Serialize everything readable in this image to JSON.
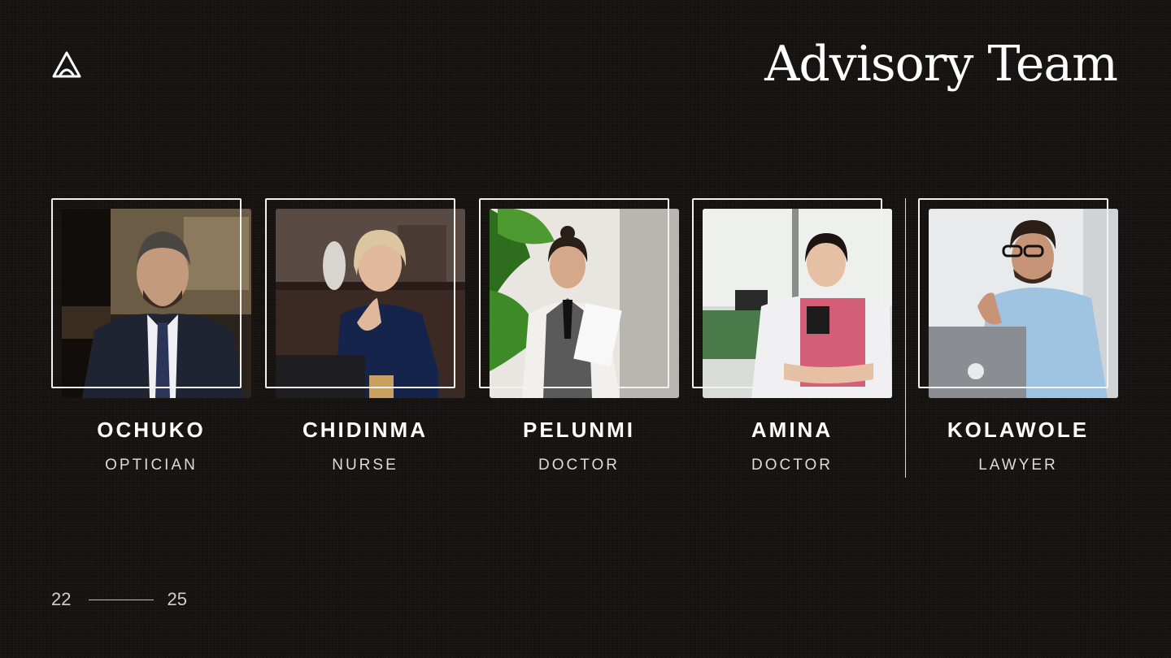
{
  "slide": {
    "title": "Advisory Team"
  },
  "team": [
    {
      "name": "OCHUKO",
      "role": "OPTICIAN"
    },
    {
      "name": "CHIDINMA",
      "role": "NURSE"
    },
    {
      "name": "PELUNMI",
      "role": "DOCTOR"
    },
    {
      "name": "AMINA",
      "role": "DOCTOR"
    },
    {
      "name": "KOLAWOLE",
      "role": "LAWYER"
    }
  ],
  "pager": {
    "current": "22",
    "total": "25"
  },
  "colors": {
    "background": "#151210",
    "text": "#ffffff",
    "frame": "#f2f2f2"
  }
}
